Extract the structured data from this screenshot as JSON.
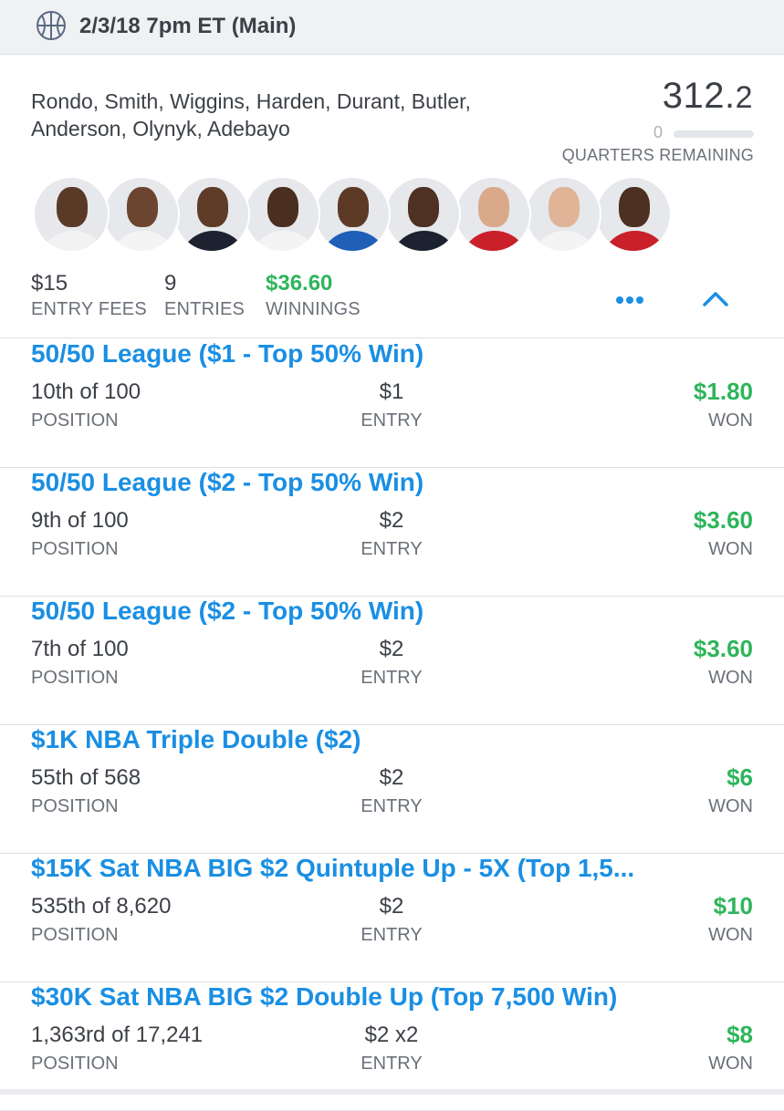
{
  "header": {
    "title": "2/3/18 7pm ET (Main)",
    "icon": "basketball-icon"
  },
  "lineup": {
    "players_line1": "Rondo, Smith, Wiggins, Harden, Durant, Butler,",
    "players_line2": "Anderson, Olynyk, Adebayo",
    "score_main": "312.",
    "score_dec": "2",
    "quarters_remaining_value": "0",
    "quarters_remaining_label": "QUARTERS REMAINING"
  },
  "avatars": [
    {
      "name": "Rondo",
      "skin": "#5a3a27",
      "jersey": "#f2f2f2"
    },
    {
      "name": "Smith",
      "skin": "#6b4530",
      "jersey": "#f4f4f4"
    },
    {
      "name": "Wiggins",
      "skin": "#5e3c28",
      "jersey": "#1d2230"
    },
    {
      "name": "Harden",
      "skin": "#4a2f20",
      "jersey": "#f4f4f4"
    },
    {
      "name": "Durant",
      "skin": "#5c3a26",
      "jersey": "#1f5fb8"
    },
    {
      "name": "Butler",
      "skin": "#4e3122",
      "jersey": "#1d2230"
    },
    {
      "name": "Anderson",
      "skin": "#d9a98a",
      "jersey": "#c9202a"
    },
    {
      "name": "Olynyk",
      "skin": "#e0b497",
      "jersey": "#f4f4f4"
    },
    {
      "name": "Adebayo",
      "skin": "#4d3022",
      "jersey": "#c9202a"
    }
  ],
  "stats": {
    "entry_fees_value": "$15",
    "entry_fees_label": "ENTRY FEES",
    "entries_value": "9",
    "entries_label": "ENTRIES",
    "winnings_value": "$36.60",
    "winnings_label": "WINNINGS"
  },
  "labels": {
    "position": "POSITION",
    "entry": "ENTRY",
    "won": "WON"
  },
  "contests": [
    {
      "name": "50/50 League ($1 - Top 50% Win)",
      "position": "10th of 100",
      "entry": "$1",
      "won": "$1.80"
    },
    {
      "name": "50/50 League ($2 - Top 50% Win)",
      "position": "9th of 100",
      "entry": "$2",
      "won": "$3.60"
    },
    {
      "name": "50/50 League ($2 - Top 50% Win)",
      "position": "7th of 100",
      "entry": "$2",
      "won": "$3.60"
    },
    {
      "name": "$1K NBA Triple Double ($2)",
      "position": "55th of 568",
      "entry": "$2",
      "won": "$6"
    },
    {
      "name": "$15K Sat NBA BIG $2 Quintuple Up - 5X (Top 1,5...",
      "position": "535th of 8,620",
      "entry": "$2",
      "won": "$10"
    },
    {
      "name": "$30K Sat NBA BIG $2 Double Up (Top 7,500 Win)",
      "position": "1,363rd of 17,241",
      "entry": "$2 x2",
      "won": "$8"
    }
  ],
  "colors": {
    "accent": "#1a8fe3",
    "won": "#2eb55a"
  }
}
